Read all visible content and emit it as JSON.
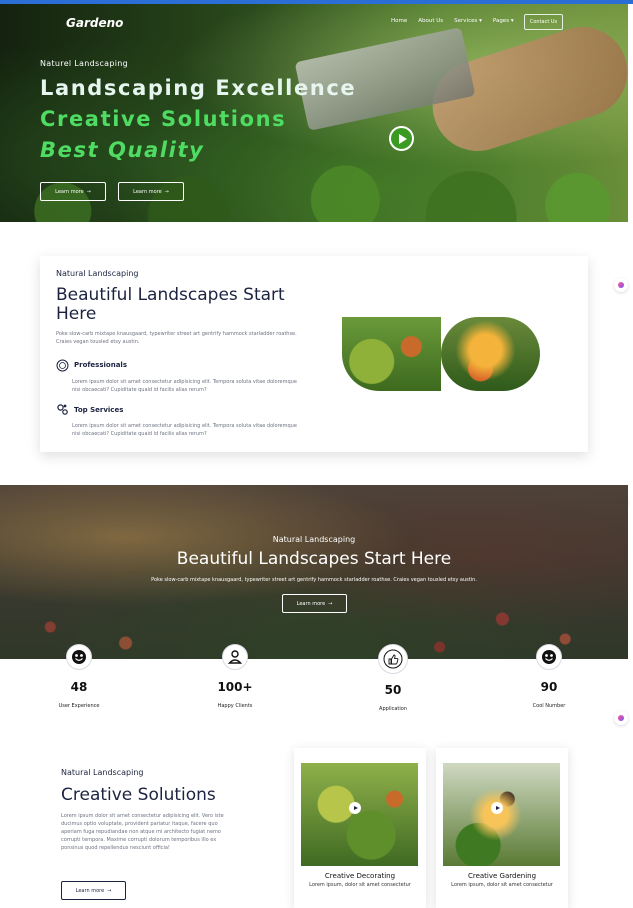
{
  "nav": {
    "logo": "Gardeno",
    "items": [
      "Home",
      "About Us",
      "Services",
      "Pages"
    ],
    "contact": "Contact Us"
  },
  "hero": {
    "subtitle": "Naturel Landscaping",
    "line1": "Landscaping Excellence",
    "line2": "Creative Solutions",
    "line3": "Best Quality",
    "btn1": "Learn more",
    "btn2": "Learn more"
  },
  "about": {
    "subtitle": "Natural Landscaping",
    "title": "Beautiful Landscapes Start Here",
    "desc": "Poke slow-carb mixtape knausgaard, typewriter street art gentrify hammock starladder roathse. Craies vegan tousled etsy austin.",
    "features": [
      {
        "title": "Professionals",
        "text": "Lorem ipsum dolor sit amet consectetur adipisicing elit. Tempora soluta vitae doloremque nisi obcaecati? Cupiditate quaid id facilis alias rerum?"
      },
      {
        "title": "Top Services",
        "text": "Lorem ipsum dolor sit amet consectetur adipisicing elit. Tempora soluta vitae doloremque nisi obcaecati? Cupiditate quaid id facilis alias rerum?"
      }
    ]
  },
  "banner": {
    "subtitle": "Natural Landscaping",
    "title": "Beautiful Landscapes Start Here",
    "desc": "Poke slow-carb mixtape knausgaard, typewriter street art gentrify hammock starladder roathse. Craies vegan tousled etsy austin.",
    "button": "Learn more"
  },
  "stats": [
    {
      "value": "48",
      "label": "User Experience",
      "icon": "smile-face-icon"
    },
    {
      "value": "100+",
      "label": "Happy Clients",
      "icon": "users-icon"
    },
    {
      "value": "50",
      "label": "Application",
      "icon": "thumbs-up-icon"
    },
    {
      "value": "90",
      "label": "Cool Number",
      "icon": "smile-face-icon"
    }
  ],
  "creative": {
    "subtitle": "Natural Landscaping",
    "title": "Creative Solutions",
    "desc": "Lorem ipsum dolor sit amet consectetur adipisicing elit. Vero iste ducimus optio voluptate, provident pariatur itaque, facere quo aperiam fuga repudiandae non atque mi architecto fugiat nemo corrupti tempora. Maxime corrupti dolorum temporibus illo ex ponsinus quod repellendus nesciunt officia!",
    "button": "Learn more",
    "cards": [
      {
        "title": "Creative Decorating",
        "text": "Lorem ipsum, dolor sit amet consectetur"
      },
      {
        "title": "Creative Gardening",
        "text": "Lorem ipsum, dolor sit amet consectetur"
      }
    ]
  },
  "colors": {
    "accent": "#4fdc63",
    "navy": "#1c2340",
    "play": "#3a9a22"
  }
}
